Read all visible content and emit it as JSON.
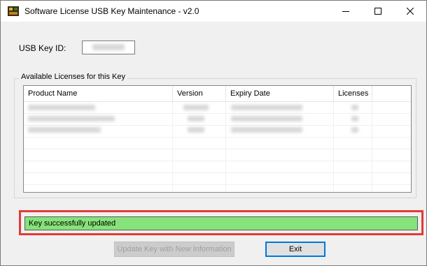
{
  "window": {
    "title": "Software License USB Key Maintenance - v2.0",
    "controls": {
      "minimize": "minimize",
      "maximize": "maximize",
      "close": "close"
    }
  },
  "usb_key": {
    "label": "USB Key ID:"
  },
  "licenses_group": {
    "label": "Available Licenses for this Key",
    "columns": [
      "Product Name",
      "Version",
      "Expiry Date",
      "Licenses"
    ]
  },
  "status": {
    "message": "Key successfully updated",
    "color": "#86e27a",
    "highlight_color": "#e53935"
  },
  "buttons": {
    "update": "Update Key with New Information",
    "exit": "Exit"
  }
}
